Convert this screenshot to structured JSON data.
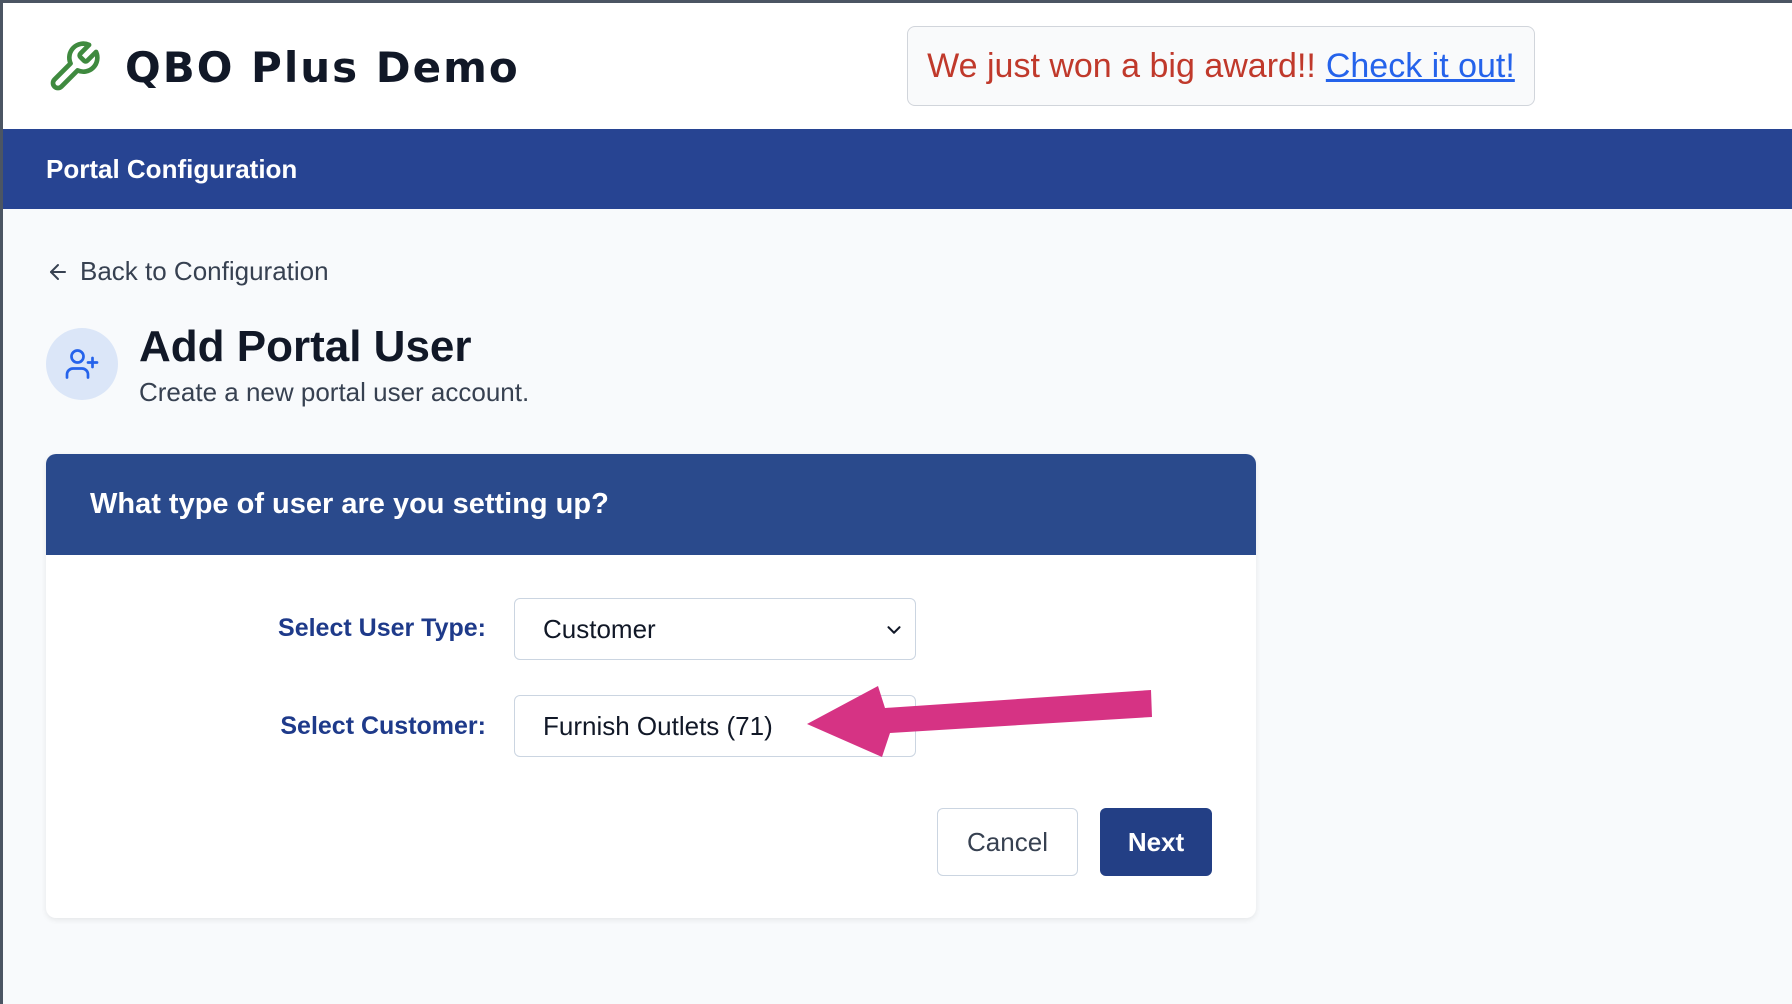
{
  "header": {
    "app_title": "QBO Plus Demo",
    "announcement": {
      "text": "We just won a big award!!",
      "link_text": "Check it out!"
    }
  },
  "navbar": {
    "title": "Portal Configuration"
  },
  "back_link": {
    "label": "Back to Configuration"
  },
  "page": {
    "title": "Add Portal User",
    "subtitle": "Create a new portal user account."
  },
  "form": {
    "heading": "What type of user are you setting up?",
    "user_type_label": "Select User Type:",
    "user_type_value": "Customer",
    "customer_label": "Select Customer:",
    "customer_value": "Furnish Outlets (71)",
    "cancel_label": "Cancel",
    "next_label": "Next"
  },
  "icons": {
    "logo": "wrench-icon",
    "back": "arrow-left-icon",
    "avatar": "user-plus-icon",
    "select": "chevron-down-icon",
    "annotation": "arrow-annotation"
  },
  "colors": {
    "navbar": "#274492",
    "card_header": "#2a4a8c",
    "primary_button": "#233f85",
    "label": "#1e3a8a",
    "announcement_text": "#c0392b",
    "link": "#2563eb",
    "logo_icon": "#3f8a3f",
    "annotation_arrow": "#d63384"
  }
}
